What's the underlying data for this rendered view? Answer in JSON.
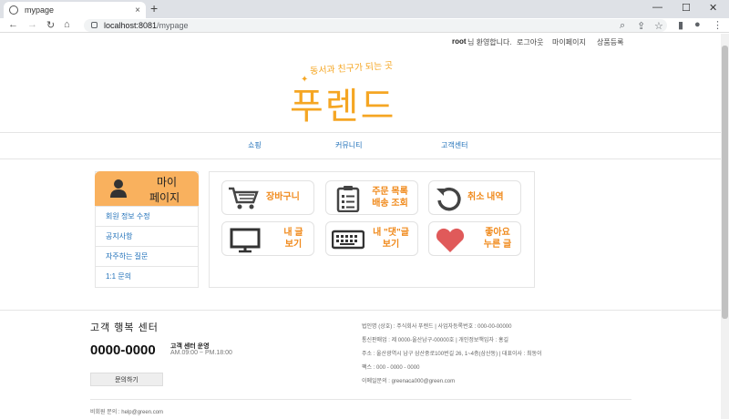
{
  "browser": {
    "tab_title": "mypage",
    "tab_close": "×",
    "new_tab": "+",
    "url_host": "localhost:8081",
    "url_path": "/mypage",
    "win_min": "—",
    "win_max": "☐",
    "win_close": "✕"
  },
  "topmenu": {
    "user": "root",
    "welcome": "님 환영합니다.",
    "logout": "로그아웃",
    "mypage": "마이페이지",
    "product_reg": "상품등록"
  },
  "brand": {
    "subtitle": "동서과 친구가 되는 곳",
    "name": "푸렌드"
  },
  "mainnav": {
    "shop": "쇼핑",
    "community": "커뮤니티",
    "support": "고객센터"
  },
  "sidebar": {
    "title_line1": "마이",
    "title_line2": "페이지",
    "items": [
      "회원 정보 수정",
      "공지사항",
      "자주하는 질문",
      "1:1 문의"
    ]
  },
  "cards": [
    {
      "line1": "장바구니",
      "line2": "",
      "icon": "cart-icon"
    },
    {
      "line1": "주문 목록",
      "line2": "배송 조회",
      "icon": "clipboard-icon"
    },
    {
      "line1": "취소 내역",
      "line2": "",
      "icon": "refresh-icon"
    },
    {
      "line1": "내 글",
      "line2": "보기",
      "icon": "monitor-icon"
    },
    {
      "line1": "내 \"댓\"글",
      "line2": "보기",
      "icon": "keyboard-icon"
    },
    {
      "line1": "좋아요",
      "line2": "누른 글",
      "icon": "heart-icon"
    }
  ],
  "colors": {
    "accent": "#f5a623",
    "link": "#1e6fb8",
    "card_text": "#f08a1c",
    "side_head": "#f9b15e"
  },
  "footer": {
    "title": "고객 행복 센터",
    "phone": "0000-0000",
    "hours_title": "고객 센터 운영",
    "hours": "AM.09:00 ~ PM.18:00",
    "inquiry_btn": "문의하기",
    "info": [
      "법인명 (상호) : 주식회사 푸렌드 | 사업자등록번호 : 000-00-00000",
      "통신판매업 : 제 0000-울산남구-00000호 | 개인정보책임자 : 홍길",
      "주소 : 울산광역시 남구 삼산중로100번길 26, 1~4층(삼산동) | 대표이사 : 최동이",
      "팩스 : 000 - 0000 - 0000",
      "이메일문의 : greenaca000@green.com"
    ],
    "bottom": "비회원 문의 : help@green.com"
  }
}
